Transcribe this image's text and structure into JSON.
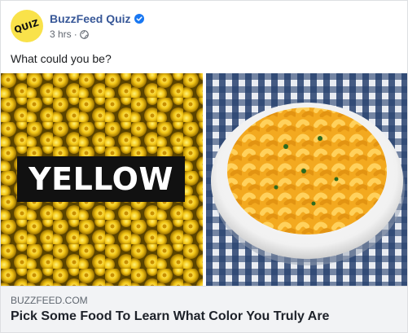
{
  "post": {
    "avatar_text": "QUIZ",
    "page_name": "BuzzFeed Quiz",
    "time": "3 hrs",
    "separator": "·",
    "caption": "What could you be?",
    "image_left_label": "YELLOW",
    "link": {
      "domain": "BUZZFEED.COM",
      "title": "Pick Some Food To Learn What Color You Truly Are"
    }
  },
  "icons": {
    "verified": "verified-badge-icon",
    "audience": "globe-icon"
  },
  "colors": {
    "brand_link": "#385898",
    "verified_blue": "#1877f2",
    "avatar_yellow": "#f9e24a",
    "link_box_bg": "#f2f3f5"
  }
}
